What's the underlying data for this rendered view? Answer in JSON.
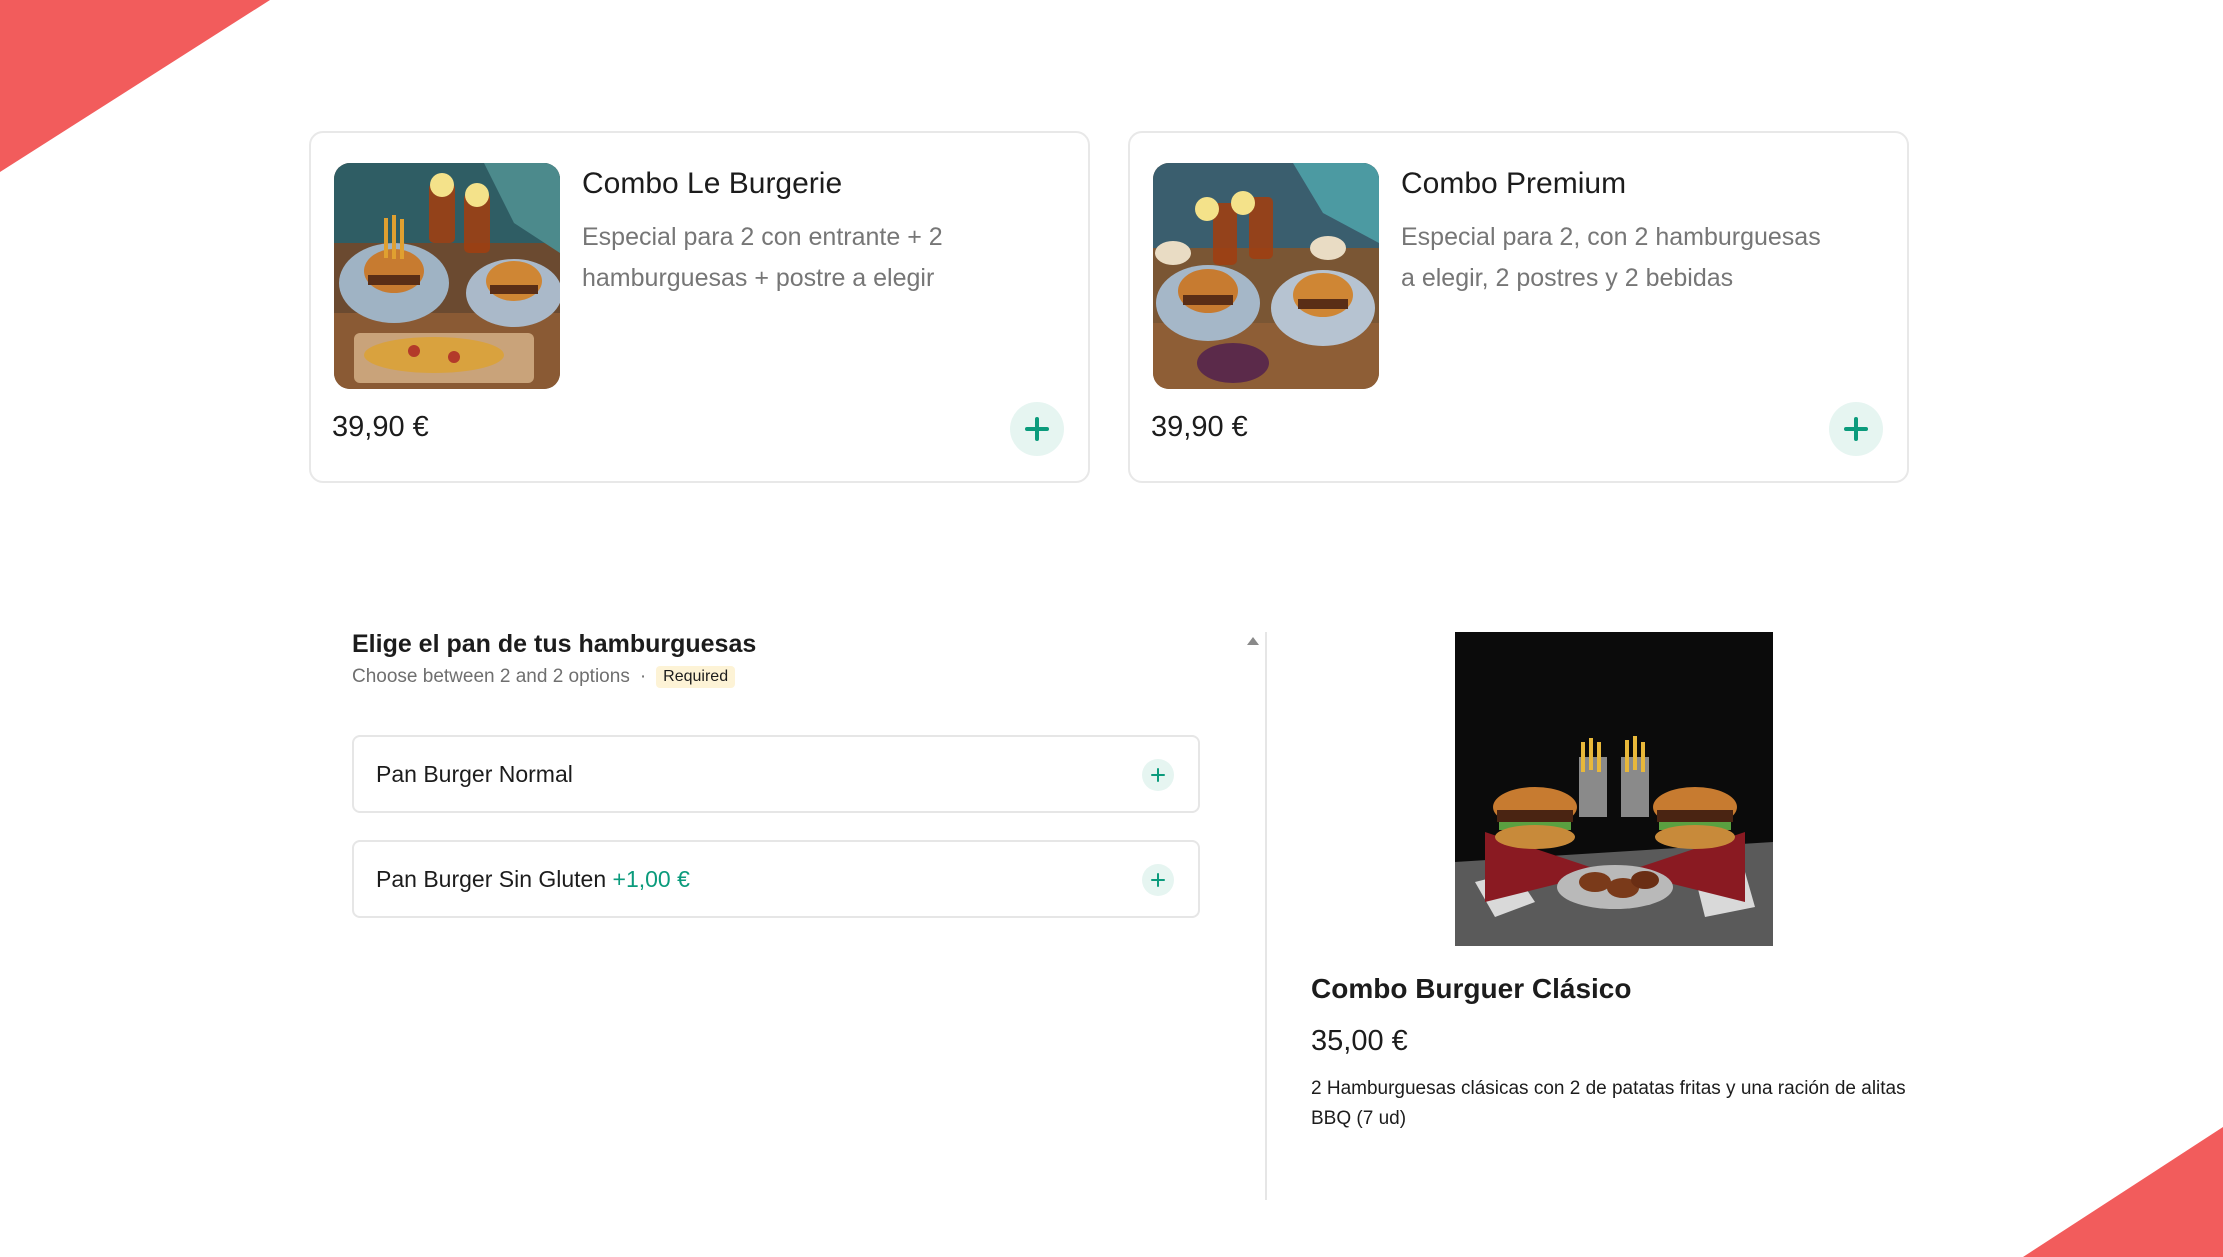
{
  "colors": {
    "accent": "#0b9b7c",
    "accent_bg": "#e6f5f1",
    "corner": "#f25c5c",
    "badge_bg": "#fdf3d6"
  },
  "cards": [
    {
      "title": "Combo Le Burgerie",
      "description": "Especial para 2 con entrante + 2 hamburguesas + postre a elegir",
      "price": "39,90 €",
      "add_icon": "plus-icon"
    },
    {
      "title": "Combo Premium",
      "description": "Especial para 2, con 2 hamburguesas a elegir, 2 postres y 2 bebidas",
      "price": "39,90 €",
      "add_icon": "plus-icon"
    }
  ],
  "options": {
    "title": "Elige el pan de tus hamburguesas",
    "subtitle": "Choose between 2 and 2 options",
    "separator": "·",
    "required_badge": "Required",
    "items": [
      {
        "label": "Pan Burger Normal",
        "extra": ""
      },
      {
        "label": "Pan Burger Sin Gluten",
        "extra": "+1,00 €"
      }
    ]
  },
  "product": {
    "title": "Combo Burguer Clásico",
    "price": "35,00 €",
    "description": "2 Hamburguesas clásicas con 2 de patatas fritas y una ración de alitas BBQ (7 ud)"
  }
}
